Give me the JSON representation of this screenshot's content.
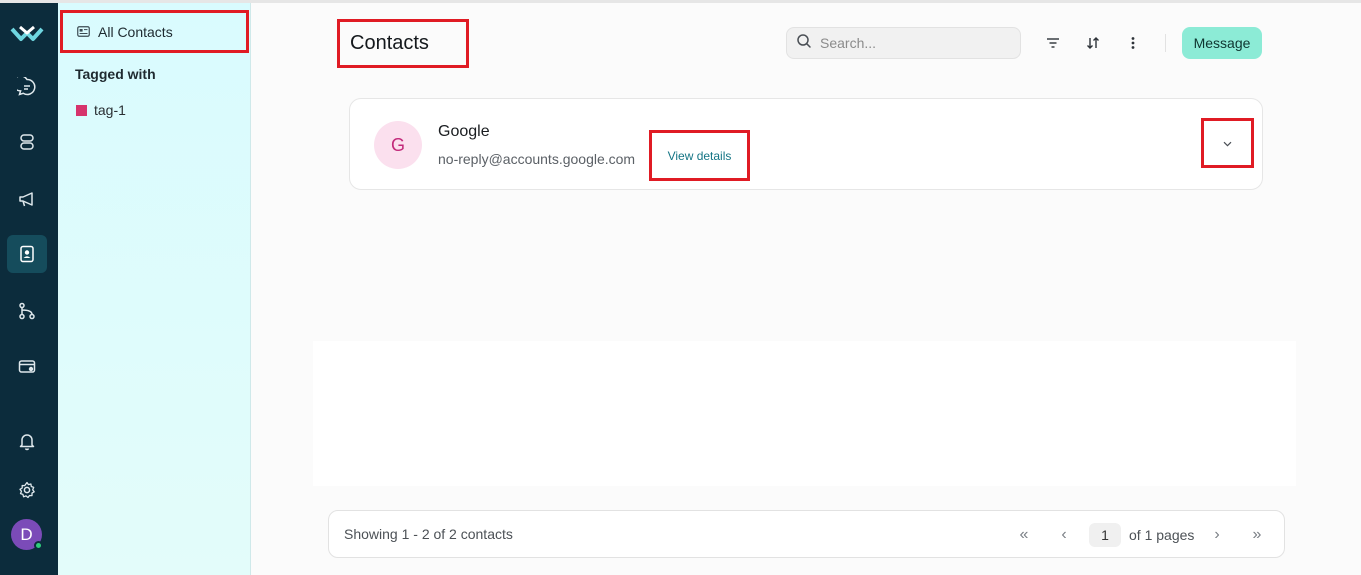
{
  "sidebar": {
    "all_contacts": "All Contacts",
    "tagged_with": "Tagged with",
    "tags": [
      {
        "label": "tag-1",
        "color": "#d6336c"
      }
    ]
  },
  "rail": {
    "icons": [
      "logo-icon",
      "chat-icon",
      "database-icon",
      "megaphone-icon",
      "contacts-icon",
      "flow-icon",
      "wallet-icon",
      "bell-icon",
      "gear-icon"
    ],
    "active": "contacts-icon",
    "avatar_initial": "D"
  },
  "header": {
    "title": "Contacts",
    "search_placeholder": "Search...",
    "message_button": "Message"
  },
  "contacts": [
    {
      "initial": "G",
      "name": "Google",
      "email": "no-reply@accounts.google.com",
      "view_details": "View details"
    }
  ],
  "footer": {
    "showing": "Showing 1 - 2 of 2 contacts",
    "current_page": "1",
    "of_pages": "of 1 pages"
  },
  "colors": {
    "rail": "#0c2c3c",
    "accent": "#8cebd6",
    "highlight_border": "#e01b24"
  }
}
